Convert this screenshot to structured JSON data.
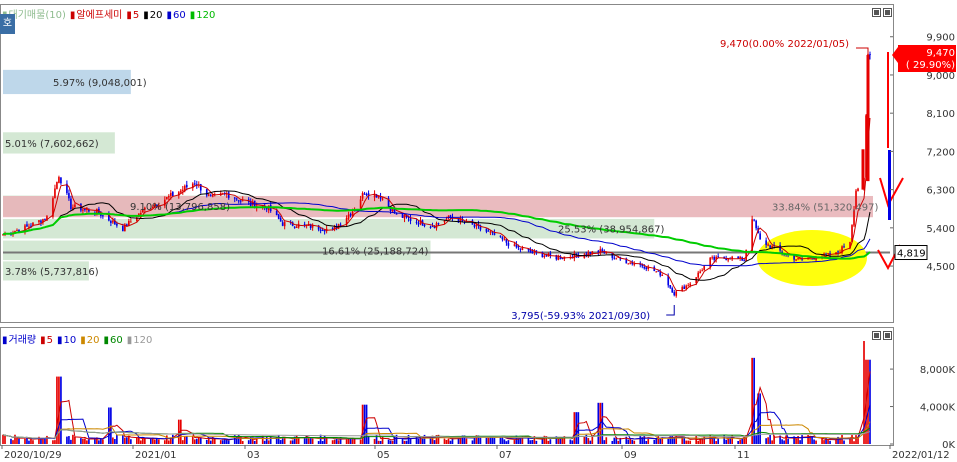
{
  "window": {
    "side_tab_label": "호"
  },
  "price_legend": {
    "items": [
      {
        "marker": "▮",
        "text": "대기매물(10)",
        "color": "#8fbc8f"
      },
      {
        "marker": "▮",
        "text": "알에프세미",
        "color": "#cc0000"
      },
      {
        "marker": "▮",
        "text": "5",
        "color": "#cc0000"
      },
      {
        "marker": "▮",
        "text": "20",
        "color": "#000000"
      },
      {
        "marker": "▮",
        "text": "60",
        "color": "#0000cc"
      },
      {
        "marker": "▮",
        "text": "120",
        "color": "#00bb00"
      }
    ]
  },
  "volume_legend": {
    "items": [
      {
        "marker": "▮",
        "text": "거래량",
        "color": "#0000cc"
      },
      {
        "marker": "▮",
        "text": "5",
        "color": "#cc0000"
      },
      {
        "marker": "▮",
        "text": "10",
        "color": "#0000cc"
      },
      {
        "marker": "▮",
        "text": "20",
        "color": "#cc8800"
      },
      {
        "marker": "▮",
        "text": "60",
        "color": "#008800"
      },
      {
        "marker": "▮",
        "text": "120",
        "color": "#999999"
      }
    ]
  },
  "colors": {
    "up": "#e60000",
    "down": "#0000e6",
    "ma5": "#cc0000",
    "ma20": "#000000",
    "ma60": "#0000cc",
    "ma120": "#00cc00",
    "supply_band": "#cfe6cf",
    "supply_band_top": "#b7d3e8",
    "resistance_band": "#e8b4b8",
    "highlight": "#ffff00",
    "price_tag_bg": "#ff0000",
    "grid": "#c8c8c8"
  },
  "chart_data": [
    {
      "type": "candlestick",
      "title": "알에프세미",
      "x_axis": {
        "range": [
          "2020/10/29",
          "2022/01/12"
        ],
        "tick_labels": [
          "2020/10/29",
          "2021/01",
          "03",
          "05",
          "07",
          "09",
          "11",
          "2022/01/12"
        ]
      },
      "y_axis": {
        "range": [
          3500,
          9900
        ],
        "tick_labels": [
          "9,900",
          "9,000",
          "8,100",
          "7,200",
          "6,300",
          "5,400",
          "4,500"
        ],
        "tick_values": [
          9900,
          9000,
          8100,
          7200,
          6300,
          5400,
          4500
        ],
        "side": "right"
      },
      "grid": false,
      "last_price": {
        "value": "9,470",
        "change": "( 29.90%)"
      },
      "current_line": {
        "value": 4819,
        "label": "4,819"
      },
      "annotations": {
        "high": "9,470(0.00% 2022/01/05)",
        "low": "3,795(-59.93% 2021/09/30)"
      },
      "supply_zones": [
        {
          "label": "5.97% (9,048,001)",
          "price_from": 8550,
          "price_to": 9120,
          "date_to": "2021/01/01"
        },
        {
          "label": "5.01% (7,602,662)",
          "price_from": 7150,
          "price_to": 7650,
          "date_to": "2020/12/24"
        },
        {
          "label": "9.10% (13,796,858)",
          "price_from": 5680,
          "price_to": 6160,
          "date_to": "2021/03/03"
        },
        {
          "label": "33.84% (51,320,497)",
          "price_from": 5650,
          "price_to": 6150,
          "date_to": "2022/01/12"
        },
        {
          "label": "25.53% (38,954,867)",
          "price_from": 5150,
          "price_to": 5610,
          "date_to": "2021/09/20"
        },
        {
          "label": "16.61% (25,188,724)",
          "price_from": 4640,
          "price_to": 5100,
          "date_to": "2021/05/31"
        },
        {
          "label": "3.78% (5,737,816)",
          "price_from": 4160,
          "price_to": 4610,
          "date_to": "2020/12/11"
        }
      ],
      "series": [
        {
          "name": "알에프세미",
          "type": "candle",
          "sampled_closes": [
            {
              "x": "2020/10/29",
              "y": 5250
            },
            {
              "x": "2020/11/10",
              "y": 5420
            },
            {
              "x": "2020/11/20",
              "y": 5650
            },
            {
              "x": "2020/11/26",
              "y": 6650
            },
            {
              "x": "2020/12/02",
              "y": 5900
            },
            {
              "x": "2020/12/15",
              "y": 5780
            },
            {
              "x": "2020/12/28",
              "y": 5380
            },
            {
              "x": "2021/01/08",
              "y": 5850
            },
            {
              "x": "2021/01/15",
              "y": 6000
            },
            {
              "x": "2021/01/25",
              "y": 6250
            },
            {
              "x": "2021/02/02",
              "y": 6480
            },
            {
              "x": "2021/02/10",
              "y": 6100
            },
            {
              "x": "2021/02/18",
              "y": 6200
            },
            {
              "x": "2021/03/02",
              "y": 5950
            },
            {
              "x": "2021/03/10",
              "y": 5900
            },
            {
              "x": "2021/03/18",
              "y": 5500
            },
            {
              "x": "2021/03/30",
              "y": 5450
            },
            {
              "x": "2021/04/12",
              "y": 5350
            },
            {
              "x": "2021/04/22",
              "y": 5800
            },
            {
              "x": "2021/04/28",
              "y": 6250
            },
            {
              "x": "2021/05/06",
              "y": 6150
            },
            {
              "x": "2021/05/14",
              "y": 5700
            },
            {
              "x": "2021/05/24",
              "y": 5550
            },
            {
              "x": "2021/06/01",
              "y": 5450
            },
            {
              "x": "2021/06/10",
              "y": 5650
            },
            {
              "x": "2021/06/21",
              "y": 5450
            },
            {
              "x": "2021/07/01",
              "y": 5250
            },
            {
              "x": "2021/07/12",
              "y": 4950
            },
            {
              "x": "2021/07/22",
              "y": 4800
            },
            {
              "x": "2021/08/02",
              "y": 4700
            },
            {
              "x": "2021/08/12",
              "y": 4750
            },
            {
              "x": "2021/08/24",
              "y": 4850
            },
            {
              "x": "2021/09/03",
              "y": 4650
            },
            {
              "x": "2021/09/15",
              "y": 4500
            },
            {
              "x": "2021/09/24",
              "y": 4300
            },
            {
              "x": "2021/09/30",
              "y": 3850
            },
            {
              "x": "2021/10/08",
              "y": 4100
            },
            {
              "x": "2021/10/18",
              "y": 4650
            },
            {
              "x": "2021/10/28",
              "y": 4700
            },
            {
              "x": "2021/11/04",
              "y": 4650
            },
            {
              "x": "2021/11/08",
              "y": 5650
            },
            {
              "x": "2021/11/12",
              "y": 5100
            },
            {
              "x": "2021/11/22",
              "y": 4850
            },
            {
              "x": "2021/12/01",
              "y": 4650
            },
            {
              "x": "2021/12/10",
              "y": 4720
            },
            {
              "x": "2021/12/20",
              "y": 4780
            },
            {
              "x": "2021/12/27",
              "y": 5100
            },
            {
              "x": "2021/12/30",
              "y": 6300
            },
            {
              "x": "2022/01/03",
              "y": 6500
            },
            {
              "x": "2022/01/05",
              "y": 9470
            }
          ]
        },
        {
          "name": "5",
          "type": "line"
        },
        {
          "name": "20",
          "type": "line"
        },
        {
          "name": "60",
          "type": "line"
        },
        {
          "name": "120",
          "type": "line"
        }
      ]
    },
    {
      "type": "bar",
      "title": "거래량",
      "y_axis": {
        "tick_labels": [
          "8,000K",
          "4,000K",
          "0K"
        ],
        "tick_values": [
          8000,
          4000,
          0
        ],
        "unit": "K"
      },
      "spikes": [
        {
          "x": "2020/11/26",
          "y": 7200
        },
        {
          "x": "2020/12/21",
          "y": 3900
        },
        {
          "x": "2021/01/25",
          "y": 2600
        },
        {
          "x": "2021/04/28",
          "y": 4200
        },
        {
          "x": "2021/08/12",
          "y": 3400
        },
        {
          "x": "2021/08/24",
          "y": 4400
        },
        {
          "x": "2021/11/08",
          "y": 9200
        },
        {
          "x": "2021/11/12",
          "y": 5400
        },
        {
          "x": "2022/01/03",
          "y": 11000
        },
        {
          "x": "2022/01/05",
          "y": 9000
        }
      ],
      "series": [
        {
          "name": "거래량",
          "type": "bar"
        },
        {
          "name": "5",
          "type": "line"
        },
        {
          "name": "10",
          "type": "line"
        },
        {
          "name": "20",
          "type": "line"
        },
        {
          "name": "60",
          "type": "line"
        },
        {
          "name": "120",
          "type": "line"
        }
      ]
    }
  ]
}
